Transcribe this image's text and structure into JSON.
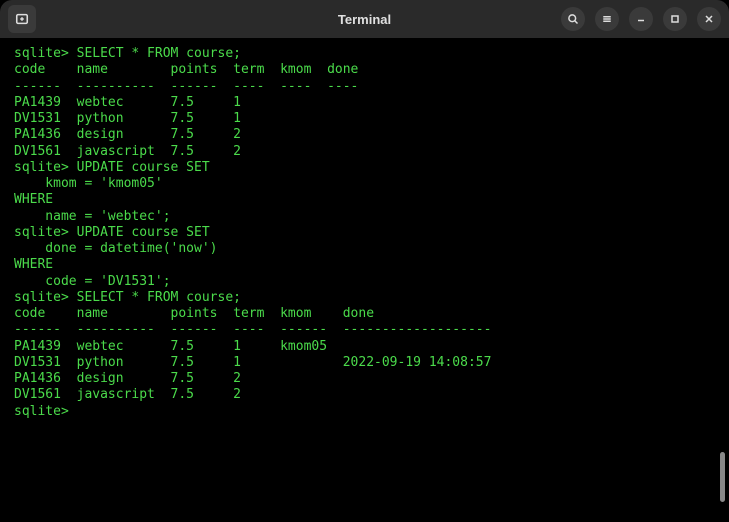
{
  "window": {
    "title": "Terminal"
  },
  "terminal": {
    "lines": [
      "sqlite> SELECT * FROM course;",
      "code    name        points  term  kmom  done",
      "------  ----------  ------  ----  ----  ----",
      "PA1439  webtec      7.5     1               ",
      "DV1531  python      7.5     1               ",
      "PA1436  design      7.5     2               ",
      "DV1561  javascript  7.5     2               ",
      "sqlite> UPDATE course SET",
      "    kmom = 'kmom05'",
      "WHERE",
      "    name = 'webtec';",
      "sqlite> UPDATE course SET",
      "    done = datetime('now')",
      "WHERE",
      "    code = 'DV1531';",
      "sqlite> SELECT * FROM course;",
      "code    name        points  term  kmom    done               ",
      "------  ----------  ------  ----  ------  -------------------",
      "PA1439  webtec      7.5     1     kmom05                     ",
      "DV1531  python      7.5     1             2022-09-19 14:08:57",
      "PA1436  design      7.5     2                                ",
      "DV1561  javascript  7.5     2                                ",
      "sqlite> "
    ]
  }
}
